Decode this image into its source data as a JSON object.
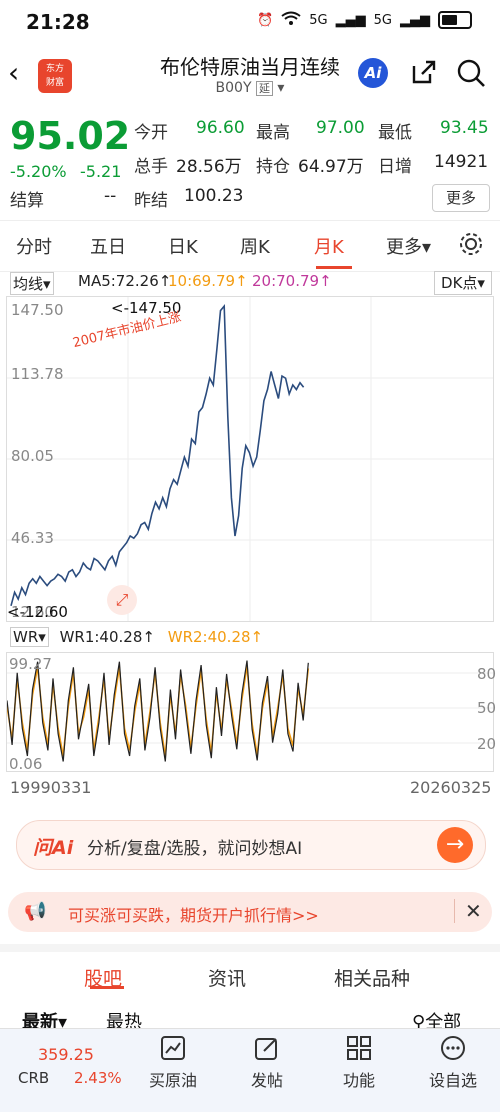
{
  "status": {
    "time": "21:28",
    "net1": "5G",
    "net2": "5G"
  },
  "header": {
    "back_icon": "back-arrow-icon",
    "logo_line1": "东方",
    "logo_line2": "财富",
    "title": "布伦特原油当月连续",
    "code": "B00Y",
    "delay_badge": "延",
    "ai_label": "Ai"
  },
  "quote": {
    "price": "95.02",
    "change_pct": "-5.20%",
    "change": "-5.21",
    "open_label": "今开",
    "open": "96.60",
    "high_label": "最高",
    "high": "97.00",
    "low_label": "最低",
    "low": "93.45",
    "volume_label": "总手",
    "volume": "28.56万",
    "oi_label": "持仓",
    "oi": "64.97万",
    "daily_add_label": "日增",
    "daily_add": "14921",
    "settle_label": "结算",
    "settle": "--",
    "prev_settle_label": "昨结",
    "prev_settle": "100.23",
    "more_label": "更多"
  },
  "tabs": {
    "items": [
      "分时",
      "五日",
      "日K",
      "周K",
      "月K",
      "更多"
    ],
    "active": "月K"
  },
  "indicators": {
    "ma_type": "均线",
    "ma5": "MA5:72.26↑",
    "ma10": "10:69.79↑",
    "ma20": "20:70.79↑",
    "dk_label": "DK点",
    "ma10_color": "#f39c12",
    "ma20_color": "#c0399b"
  },
  "chart_data": [
    {
      "type": "line",
      "title": "",
      "y_ticks": [
        "147.50",
        "113.78",
        "80.05",
        "46.33",
        "12.60"
      ],
      "ylim": [
        12.6,
        147.5
      ],
      "annotations": [
        "<-147.50",
        "<-12.60",
        "2007年市油价上涨"
      ],
      "series": [
        {
          "color": "#2b4c7e",
          "x": [
            0,
            4,
            8,
            12,
            16,
            20,
            24,
            28,
            32,
            36,
            40,
            44,
            48,
            52,
            56,
            60,
            64,
            68,
            72,
            76,
            80,
            84,
            88,
            92,
            96,
            100,
            104,
            108,
            112,
            116,
            120,
            124,
            128,
            132,
            136,
            140,
            144,
            148,
            152,
            156,
            160,
            164,
            168,
            172,
            176,
            180,
            184,
            188,
            192,
            196,
            200,
            204,
            208,
            212,
            216,
            220,
            224,
            228,
            232,
            236,
            240,
            244,
            248,
            252,
            256,
            260,
            264,
            268,
            272,
            276,
            280,
            284,
            288,
            292,
            296,
            300,
            304,
            308,
            312,
            316,
            320,
            324
          ],
          "values": [
            14,
            20,
            17,
            22,
            19,
            24,
            26,
            24,
            27,
            25,
            23,
            25,
            26,
            28,
            27,
            25,
            29,
            30,
            27,
            29,
            33,
            31,
            30,
            35,
            34,
            32,
            30,
            34,
            36,
            32,
            38,
            40,
            42,
            45,
            44,
            46,
            50,
            51,
            48,
            55,
            60,
            57,
            62,
            58,
            66,
            70,
            68,
            74,
            80,
            76,
            88,
            86,
            100,
            102,
            108,
            115,
            112,
            128,
            145,
            147,
            98,
            62,
            45,
            54,
            75,
            85,
            82,
            76,
            80,
            92,
            105,
            110,
            118,
            112,
            106,
            116,
            115,
            108,
            112,
            110,
            113,
            111
          ]
        }
      ]
    },
    {
      "type": "line",
      "title": "",
      "y_ticks": [
        "99.27",
        "0.06"
      ],
      "right_ticks": [
        "80",
        "50",
        "20"
      ],
      "ylim": [
        0.06,
        99.27
      ],
      "x_start": "19990331",
      "x_end": "20260325",
      "series": [
        {
          "name": "WR1:40.28↑",
          "color": "#222222",
          "values": [
            60,
            20,
            85,
            35,
            10,
            70,
            95,
            40,
            15,
            80,
            30,
            5,
            60,
            90,
            25,
            50,
            75,
            10,
            40,
            85,
            20,
            65,
            95,
            30,
            10,
            55,
            80,
            15,
            45,
            90,
            35,
            5,
            70,
            25,
            88,
            50,
            12,
            60,
            92,
            38,
            8,
            72,
            28,
            84,
            46,
            16,
            66,
            96,
            34,
            6,
            58,
            82,
            22,
            48,
            88,
            30,
            14,
            76,
            42,
            94
          ]
        },
        {
          "name": "WR2:40.28↑",
          "color": "#f39c12",
          "values": [
            55,
            25,
            80,
            40,
            15,
            65,
            90,
            45,
            20,
            75,
            35,
            10,
            55,
            85,
            30,
            45,
            70,
            15,
            45,
            80,
            25,
            60,
            90,
            35,
            15,
            50,
            75,
            20,
            50,
            85,
            40,
            10,
            65,
            30,
            83,
            55,
            17,
            55,
            87,
            43,
            13,
            67,
            33,
            79,
            51,
            21,
            61,
            91,
            39,
            11,
            53,
            77,
            27,
            53,
            83,
            35,
            19,
            71,
            47,
            89
          ]
        }
      ]
    }
  ],
  "chart_labels": {
    "wr_type": "WR",
    "wr1": "WR1:40.28↑",
    "wr2": "WR2:40.28↑",
    "x_start": "19990331",
    "x_end": "20260325"
  },
  "ai_bar": {
    "logo": "问Ai",
    "text": "分析/复盘/选股，就问妙想AI"
  },
  "promo": {
    "text": "可买涨可买跌，期货开户抓行情>>"
  },
  "sub_tabs": {
    "items": [
      "股吧",
      "资讯",
      "相关品种"
    ],
    "active": "股吧"
  },
  "filters": {
    "latest": "最新",
    "hottest": "最热",
    "all": "全部"
  },
  "bottom": {
    "crb_price": "359.25",
    "crb_name": "CRB",
    "crb_pct": "2.43%",
    "nav": [
      {
        "label": "买原油",
        "icon": "chart-icon"
      },
      {
        "label": "发帖",
        "icon": "edit-icon"
      },
      {
        "label": "功能",
        "icon": "grid-icon"
      },
      {
        "label": "设自选",
        "icon": "more-icon"
      }
    ]
  }
}
